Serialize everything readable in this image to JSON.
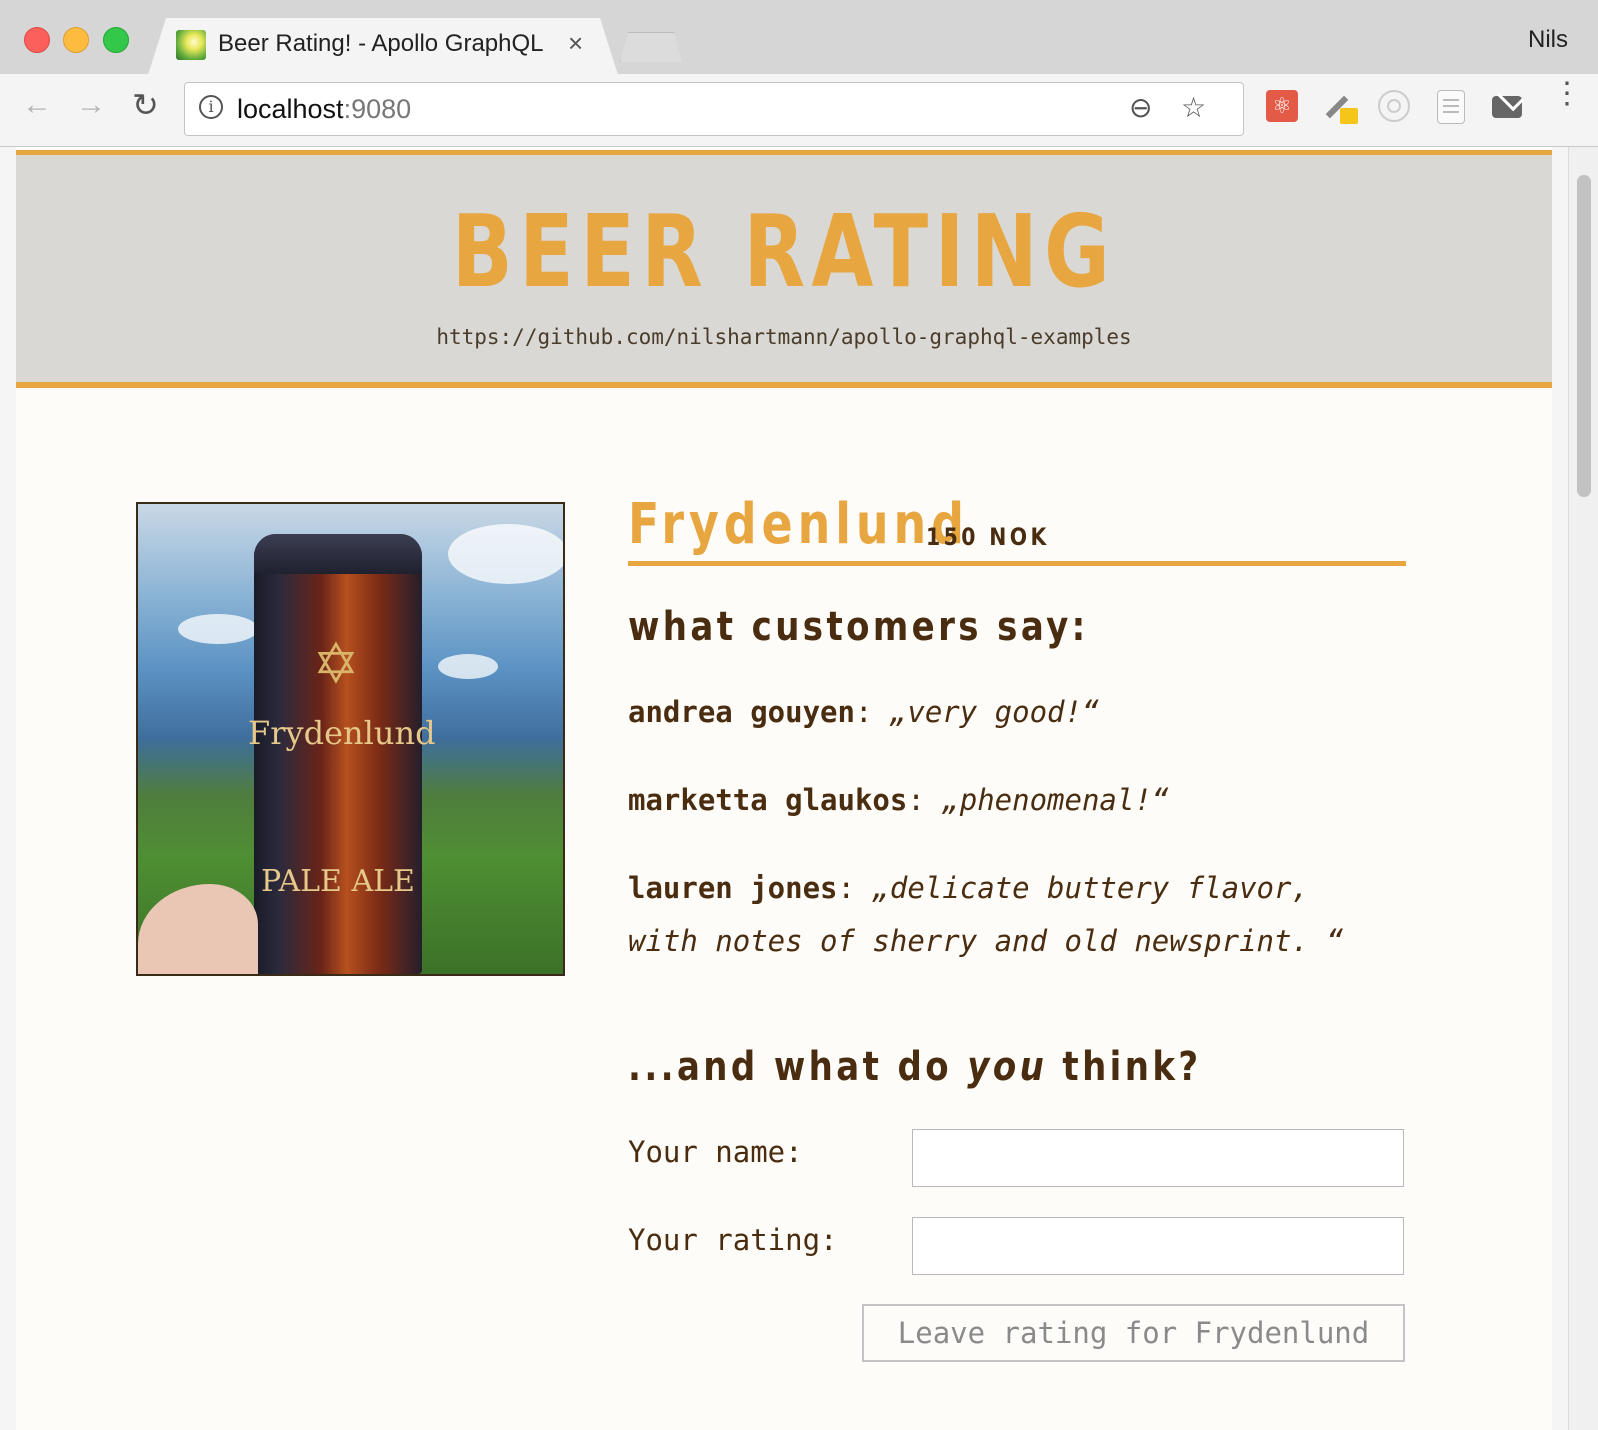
{
  "browser": {
    "tab_title": "Beer Rating! - Apollo GraphQL",
    "tab_close": "×",
    "profile_name": "Nils",
    "url_host": "localhost",
    "url_port": ":9080",
    "nav": {
      "back": "←",
      "forward": "→",
      "reload": "↻"
    },
    "omnibox_icons": {
      "zoom": "⊖",
      "bookmark": "☆"
    },
    "extensions": [
      "react-devtools-icon",
      "color-picker-icon",
      "target-icon",
      "notes-icon",
      "mail-icon"
    ],
    "menu": "⋮"
  },
  "header": {
    "title": "BEER RATING",
    "repo_url": "https://github.com/nilshartmann/apollo-graphql-examples",
    "accent_color": "#e8a640",
    "background_color": "#d9d8d4"
  },
  "beer": {
    "name": "Frydenlund",
    "price": "150 NOK",
    "photo": {
      "can_brand": "Frydenlund",
      "can_style": "PALE ALE",
      "can_emblem": "✡"
    }
  },
  "ratings_section": {
    "heading": "what customers say:",
    "ratings": [
      {
        "author": "andrea gouyen",
        "separator": ": ",
        "comment": "„very good!“"
      },
      {
        "author": "marketta glaukos",
        "separator": ": ",
        "comment": "„phenomenal!“"
      },
      {
        "author": "lauren jones",
        "separator": ": ",
        "comment": "„delicate buttery flavor, with notes of sherry and old newsprint. “"
      }
    ]
  },
  "form": {
    "heading_prefix": "...and what do ",
    "heading_emphasis": "you",
    "heading_suffix": " think?",
    "name_label": "Your name:",
    "name_value": "",
    "rating_label": "Your rating:",
    "rating_value": "",
    "submit_label": "Leave rating for Frydenlund"
  }
}
